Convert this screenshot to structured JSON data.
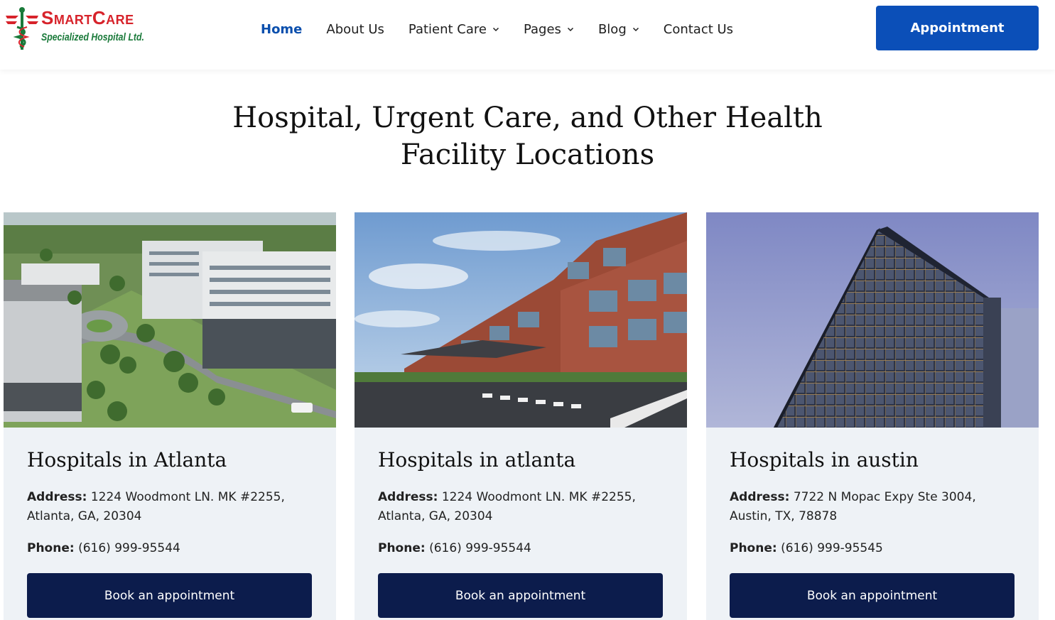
{
  "header": {
    "logo": {
      "brand": "SmartCare",
      "subtitle": "Specialized Hospital Ltd."
    },
    "nav": [
      {
        "label": "Home",
        "active": true
      },
      {
        "label": "About Us"
      },
      {
        "label": "Patient Care",
        "dropdown": true
      },
      {
        "label": "Pages",
        "dropdown": true
      },
      {
        "label": "Blog",
        "dropdown": true
      },
      {
        "label": "Contact Us"
      }
    ],
    "cta_label": "Appointment"
  },
  "main": {
    "heading_line1": "Hospital, Urgent Care, and Other Health",
    "heading_line2": "Facility Locations",
    "cards": [
      {
        "title": "Hospitals in Atlanta",
        "address_label": "Address:",
        "address": "1224 Woodmont LN. MK #2255, Atlanta, GA, 20304",
        "phone_label": "Phone:",
        "phone": "(616) 999-95544",
        "button": "Book an appointment",
        "image": "aerial-hospital-campus"
      },
      {
        "title": "Hospitals in atlanta",
        "address_label": "Address:",
        "address": "1224 Woodmont LN. MK #2255, Atlanta, GA, 20304",
        "phone_label": "Phone:",
        "phone": "(616) 999-95544",
        "button": "Book an appointment",
        "image": "brick-hospital-entrance"
      },
      {
        "title": "Hospitals in austin",
        "address_label": "Address:",
        "address": "7722 N Mopac Expy Ste 3004, Austin, TX, 78878",
        "phone_label": "Phone:",
        "phone": "(616) 999-95545",
        "button": "Book an appointment",
        "image": "glass-hospital-tower"
      }
    ]
  },
  "colors": {
    "primary": "#0b4fb8",
    "active_nav": "#0b4fad",
    "dark_button": "#0c1c4c",
    "card_bg": "#eef2f6",
    "logo_red": "#d7232b",
    "logo_green": "#1a7a3a"
  }
}
